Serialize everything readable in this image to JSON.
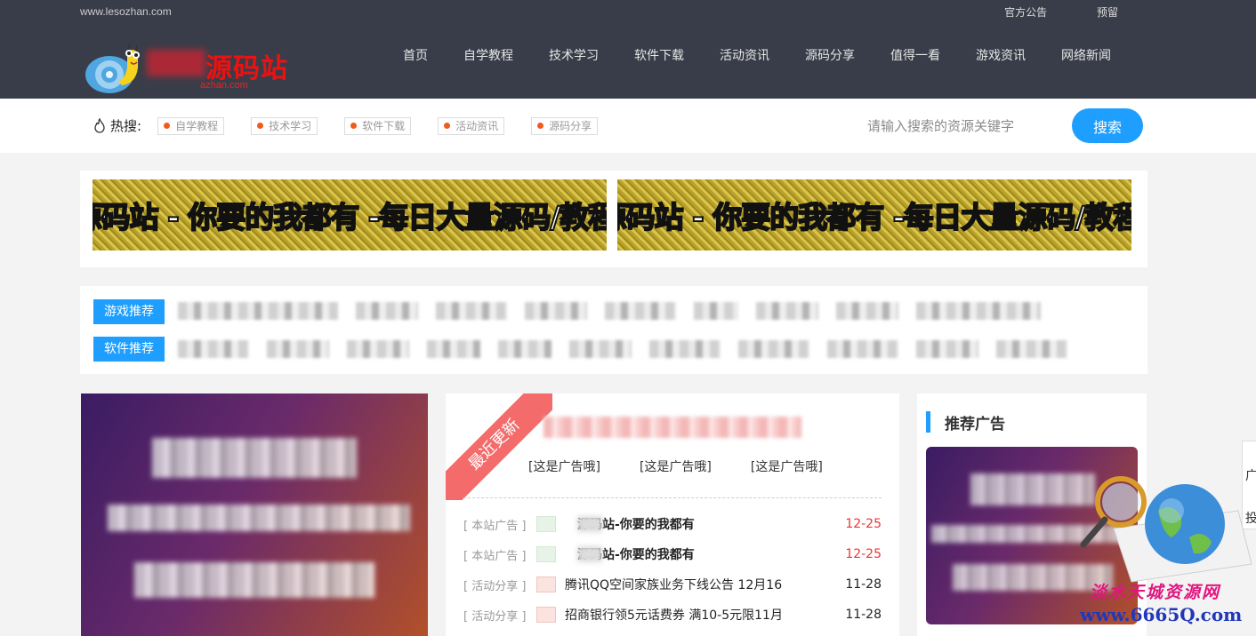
{
  "topbar": {
    "domain": "www.lesozhan.com",
    "links": [
      "官方公告",
      "预留"
    ]
  },
  "logo": {
    "text": "源码站",
    "sub": "azhan.com"
  },
  "nav": [
    "首页",
    "自学教程",
    "技术学习",
    "软件下载",
    "活动资讯",
    "源码分享",
    "值得一看",
    "游戏资讯",
    "网络新闻"
  ],
  "search": {
    "hot_label": "热搜:",
    "hot_tags": [
      "自学教程",
      "技术学习",
      "软件下载",
      "活动资讯",
      "源码分享"
    ],
    "placeholder": "请输入搜索的资源关键字",
    "button": "搜索"
  },
  "banners": [
    "乐搜源码站 - 你要的我都有 -每日大量源码/教程/活动",
    "乐搜源码站 - 你要的我都有 -每日大量源码/教程/活动"
  ],
  "recommend": {
    "game_label": "游戏推荐",
    "software_label": "软件推荐"
  },
  "latest": {
    "ribbon": "最近更新",
    "ads": [
      "[这是广告哦]",
      "[这是广告哦]",
      "[这是广告哦]"
    ],
    "items": [
      {
        "category": "[ 本站广告 ]",
        "title": "源码站-你要的我都有",
        "date": "12-25",
        "highlight": true
      },
      {
        "category": "[ 本站广告 ]",
        "title": "源码站-你要的我都有",
        "date": "12-25",
        "highlight": true
      },
      {
        "category": "[ 活动分享 ]",
        "title": "腾讯QQ空间家族业务下线公告 12月16",
        "date": "11-28",
        "highlight": false
      },
      {
        "category": "[ 活动分享 ]",
        "title": "招商银行领5元话费券 满10-5元限11月",
        "date": "11-28",
        "highlight": false
      }
    ]
  },
  "sidebar": {
    "heading": "推荐广告",
    "float_chars": [
      "广",
      "投"
    ]
  },
  "watermark": {
    "line1": "淡水天城资源网",
    "line2": "www.6665Q.com"
  },
  "colors": {
    "accent": "#1e9fff",
    "header_bg": "#393d49",
    "ribbon": "#f46b6b",
    "date_red": "#e33333"
  }
}
